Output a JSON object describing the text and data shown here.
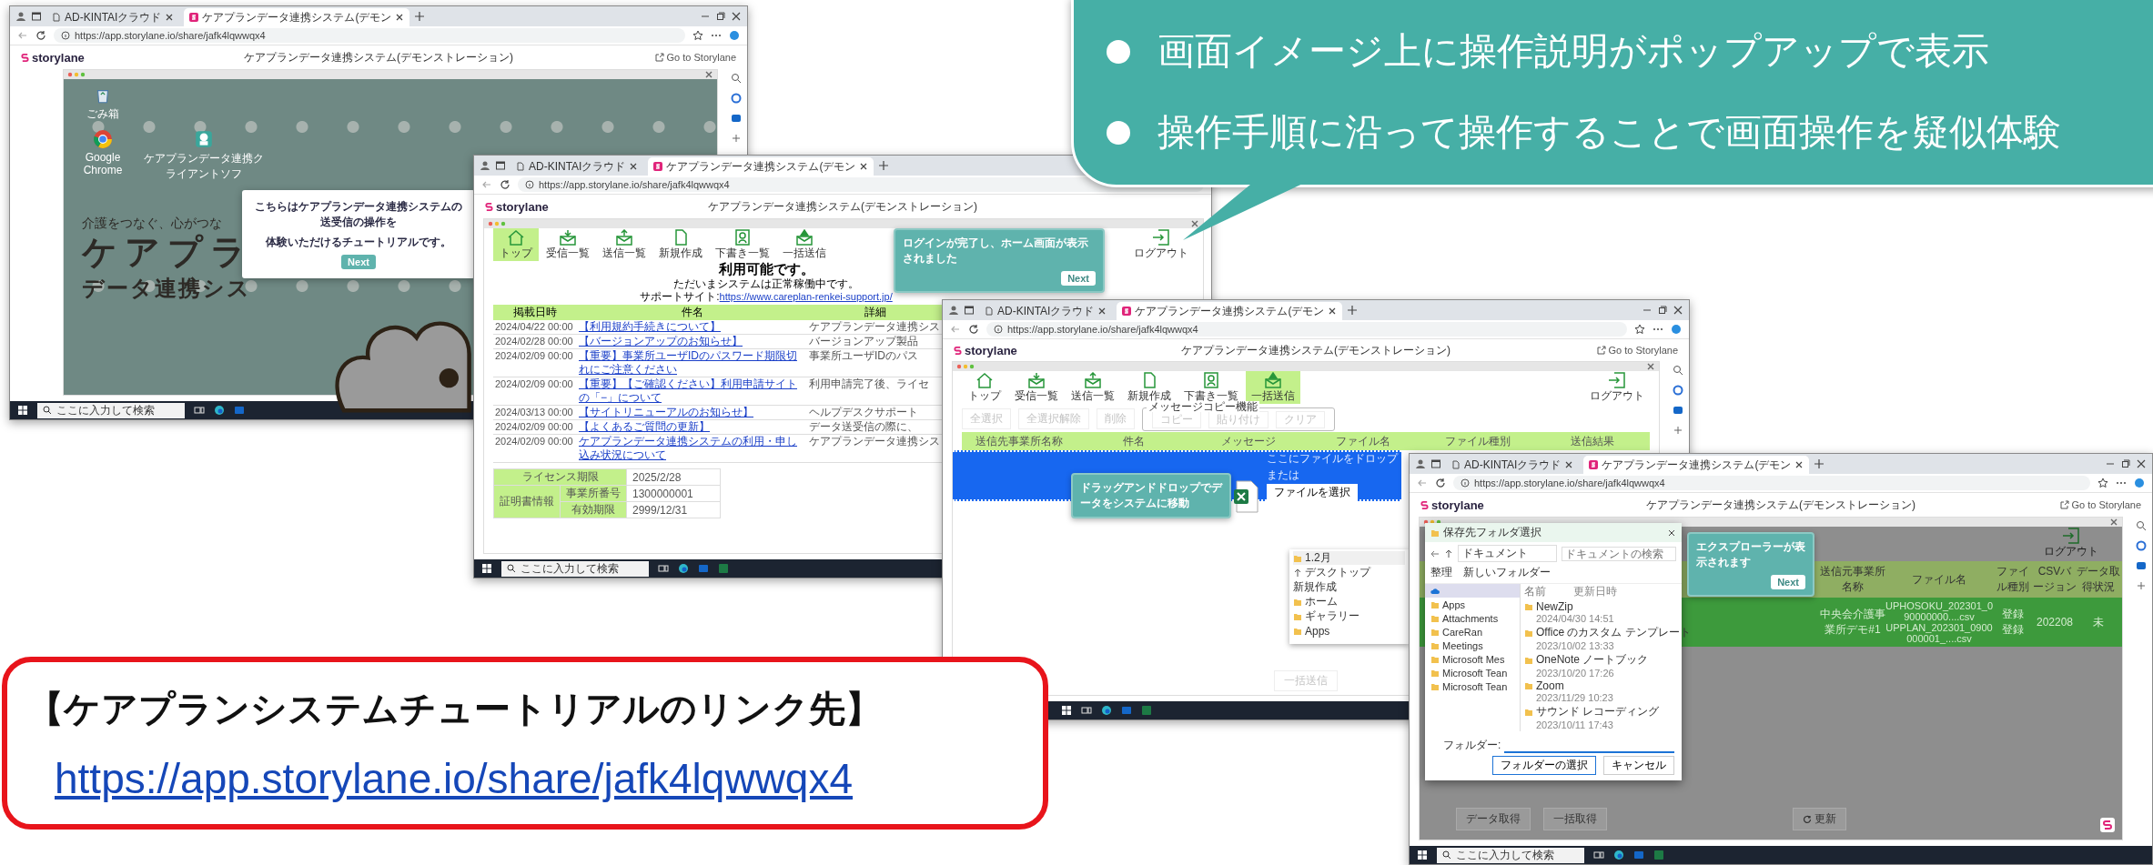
{
  "windows": [
    {
      "kind": "desktop",
      "controls": true,
      "tabs": [
        {
          "label": "AD-KINTAIクラウド",
          "selected": false
        },
        {
          "label": "ケアプランデータ連携システム(デモン",
          "selected": true
        }
      ],
      "url": "https://app.storylane.io/share/jafk4lqwwqx4",
      "brand": "storylane",
      "title": "ケアプランデータ連携システム(デモンストレーション)",
      "go_link": "Go to Storylane",
      "desktop_icons": [
        "ごみ箱",
        "Google Chrome",
        "ケアプランデータ連携クライアントソフ"
      ],
      "logo": {
        "tagline": "介護をつなぐ、心がつな",
        "name": "ケアプラ",
        "subtitle": "データ連携シス"
      },
      "popup": {
        "lines": [
          "こちらはケアプランデータ連携システムの送受信の操作を",
          "体験いただけるチュートリアルです。"
        ],
        "button": "Next"
      },
      "taskbar_search": "ここに入力して検索"
    },
    {
      "kind": "home",
      "controls": false,
      "tabs": [
        {
          "label": "AD-KINTAIクラウド",
          "selected": false
        },
        {
          "label": "ケアプランデータ連携システム(デモン",
          "selected": true
        }
      ],
      "url": "https://app.storylane.io/share/jafk4lqwwqx4",
      "brand": "storylane",
      "title": "ケアプランデータ連携システム(デモンストレーション)",
      "toolbar": {
        "items": [
          {
            "label": "トップ",
            "selected": true
          },
          {
            "label": "受信一覧",
            "selected": false
          },
          {
            "label": "送信一覧",
            "selected": false
          },
          {
            "label": "新規作成",
            "selected": false
          },
          {
            "label": "下書き一覧",
            "selected": false
          },
          {
            "label": "一括送信",
            "selected": false
          }
        ],
        "logout": "ログアウト"
      },
      "tooltip": {
        "text": "ログインが完了し、ホーム画面が表示されました",
        "button": "Next"
      },
      "status": {
        "heading": "利用可能です。",
        "message": "ただいまシステムは正常稼働中です。",
        "support_label": "サポートサイト:",
        "support_link": "https://www.careplan-renkei-support.jp/"
      },
      "news": {
        "columns": [
          "掲載日時",
          "件名",
          "詳細"
        ],
        "rows": [
          {
            "date": "2024/04/22 00:00",
            "subject": "【利用規約手続きについて】",
            "detail": "ケアプランデータ連携シス"
          },
          {
            "date": "2024/02/28 00:00",
            "subject": "【バージョンアップのお知らせ】",
            "detail": "バージョンアップ製品"
          },
          {
            "date": "2024/02/09 00:00",
            "subject": "【重要】事業所ユーザIDのパスワード期限切れにご注意ください",
            "detail": "事業所ユーザIDのパス"
          },
          {
            "date": "2024/02/09 00:00",
            "subject": "【重要】【ご確認ください】利用申請サイトの「−」について",
            "detail": "利用申請完了後、ライセ"
          },
          {
            "date": "2024/03/13 00:00",
            "subject": "【サイトリニューアルのお知らせ】",
            "detail": "ヘルプデスクサポート"
          },
          {
            "date": "2024/02/09 00:00",
            "subject": "【よくあるご質問の更新】",
            "detail": "データ送受信の際に、"
          },
          {
            "date": "2024/02/09 00:00",
            "subject": "ケアプランデータ連携システムの利用・申し込み状況について",
            "detail": "ケアプランデータ連携シス"
          }
        ]
      },
      "license": {
        "period_label": "ライセンス期限",
        "period": "2025/2/28",
        "cert_label": "証明書情報",
        "rows": [
          {
            "label": "事業所番号",
            "value": "1300000001"
          },
          {
            "label": "有効期限",
            "value": "2999/12/31"
          }
        ]
      },
      "taskbar_search": "ここに入力して検索"
    },
    {
      "kind": "send",
      "controls": true,
      "tabs": [
        {
          "label": "AD-KINTAIクラウド",
          "selected": false
        },
        {
          "label": "ケアプランデータ連携システム(デモン",
          "selected": true
        }
      ],
      "url": "https://app.storylane.io/share/jafk4lqwwqx4",
      "brand": "storylane",
      "title": "ケアプランデータ連携システム(デモンストレーション)",
      "go_link": "Go to Storylane",
      "toolbar": {
        "items": [
          {
            "label": "トップ",
            "selected": false
          },
          {
            "label": "受信一覧",
            "selected": false
          },
          {
            "label": "送信一覧",
            "selected": false
          },
          {
            "label": "新規作成",
            "selected": false
          },
          {
            "label": "下書き一覧",
            "selected": false
          },
          {
            "label": "一括送信",
            "selected": true
          }
        ],
        "logout": "ログアウト"
      },
      "actions": [
        {
          "label": "全選択",
          "disabled": true
        },
        {
          "label": "全選択解除",
          "disabled": true
        },
        {
          "label": "削除",
          "disabled": true
        }
      ],
      "copy_group": {
        "title": "メッセージコピー機能",
        "buttons": [
          {
            "label": "コピー",
            "disabled": true
          },
          {
            "label": "貼り付け",
            "disabled": true
          },
          {
            "label": "クリア",
            "disabled": true
          }
        ]
      },
      "columns": [
        "送信先事業所名称",
        "件名",
        "メッセージ",
        "ファイル名",
        "ファイル種別",
        "送信結果"
      ],
      "drop": {
        "lines": [
          "ここにファイルをドロップ",
          "または"
        ],
        "button": "ファイルを選択"
      },
      "tooltip": {
        "text": "ドラッグアンドドロップでデータをシステムに移動"
      },
      "explorer": {
        "title": "1.2月",
        "path": "デスクトップ",
        "new": "新規作成",
        "places": [
          "ホーム",
          "ギャラリー",
          "Apps"
        ]
      },
      "bottom_button": {
        "label": "一括送信",
        "disabled": true
      }
    },
    {
      "kind": "receive",
      "controls": true,
      "tabs": [
        {
          "label": "AD-KINTAIクラウド",
          "selected": false
        },
        {
          "label": "ケアプランデータ連携システム(デモン",
          "selected": true
        }
      ],
      "url": "https://app.storylane.io/share/jafk4lqwwqx4",
      "brand": "storylane",
      "title": "ケアプランデータ連携システム(デモンストレーション)",
      "go_link": "Go to Storylane",
      "logout": "ログアウト",
      "dialog": {
        "title": "保存先フォルダ選択",
        "path": "ドキュメント",
        "search_placeholder": "ドキュメントの検索",
        "organize": "整理",
        "new_folder": "新しいフォルダー",
        "columns": [
          "名前",
          "更新日時"
        ],
        "tree": [
          "Apps",
          "Attachments",
          "CareRan",
          "Meetings",
          "Microsoft Mes",
          "Microsoft Tean",
          "Microsoft Tean"
        ],
        "files": [
          {
            "name": "NewZip",
            "date": "2024/04/30 14:51"
          },
          {
            "name": "Office のカスタム テンプレート",
            "date": "2023/10/02 13:33"
          },
          {
            "name": "OneNote ノートブック",
            "date": "2023/10/20 17:26"
          },
          {
            "name": "Zoom",
            "date": "2023/11/29 10:23"
          },
          {
            "name": "サウンド レコーディング",
            "date": "2023/10/11 17:43"
          }
        ],
        "folder_label": "フォルダー:",
        "buttons": [
          "フォルダーの選択",
          "キャンセル"
        ]
      },
      "tooltip": {
        "text": "エクスプローラーが表示されます",
        "button": "Next"
      },
      "columns": [
        "送信元事業所名称",
        "ファイル名",
        "ファイル種別",
        "CSVバージョン",
        "データ取得状況"
      ],
      "row": {
        "office": "中央会介護事業所デモ#1",
        "files": [
          "UPHOSOKU_202301_090000000....csv",
          "UPPLAN_202301_0900000001_....csv"
        ],
        "types": [
          "登録",
          "登録"
        ],
        "version": "202208",
        "status": "未"
      },
      "buttons": [
        "データ取得",
        "一括取得",
        "更新"
      ],
      "taskbar_search": "ここに入力して検索"
    }
  ],
  "callout": {
    "bullets": [
      "画面イメージ上に操作説明がポップアップで表示",
      "操作手順に沿って操作することで画面操作を疑似体験"
    ]
  },
  "link_box": {
    "heading": "【ケアプランシステムチュートリアルのリンク先】",
    "url": "https://app.storylane.io/share/jafk4lqwwqx4"
  }
}
